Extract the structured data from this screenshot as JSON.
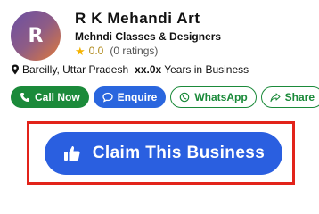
{
  "business": {
    "avatar_initial": "R",
    "name": "R K Mehandi Art",
    "tagline": "Mehndi Classes & Designers",
    "rating_value": "0.0",
    "rating_count": "(0 ratings)",
    "location": "Bareilly, Uttar Pradesh",
    "years": "xx.0x",
    "years_suffix": "Years in Business"
  },
  "actions": {
    "call_label": "Call Now",
    "enquire_label": "Enquire",
    "whatsapp_label": "WhatsApp",
    "share_label": "Share"
  },
  "claim": {
    "label": "Claim This Business"
  },
  "icons": {
    "star": "star-icon",
    "location": "map-pin-icon",
    "call": "phone-icon",
    "enquire": "chat-bubble-icon",
    "whatsapp": "whatsapp-icon",
    "share": "share-arrow-icon",
    "claim": "thumbs-up-icon"
  },
  "colors": {
    "call": "#1b8a3a",
    "enquire": "#2a66de",
    "claim": "#2a5fe0",
    "highlight": "#e2231a",
    "star": "#f5b301"
  }
}
